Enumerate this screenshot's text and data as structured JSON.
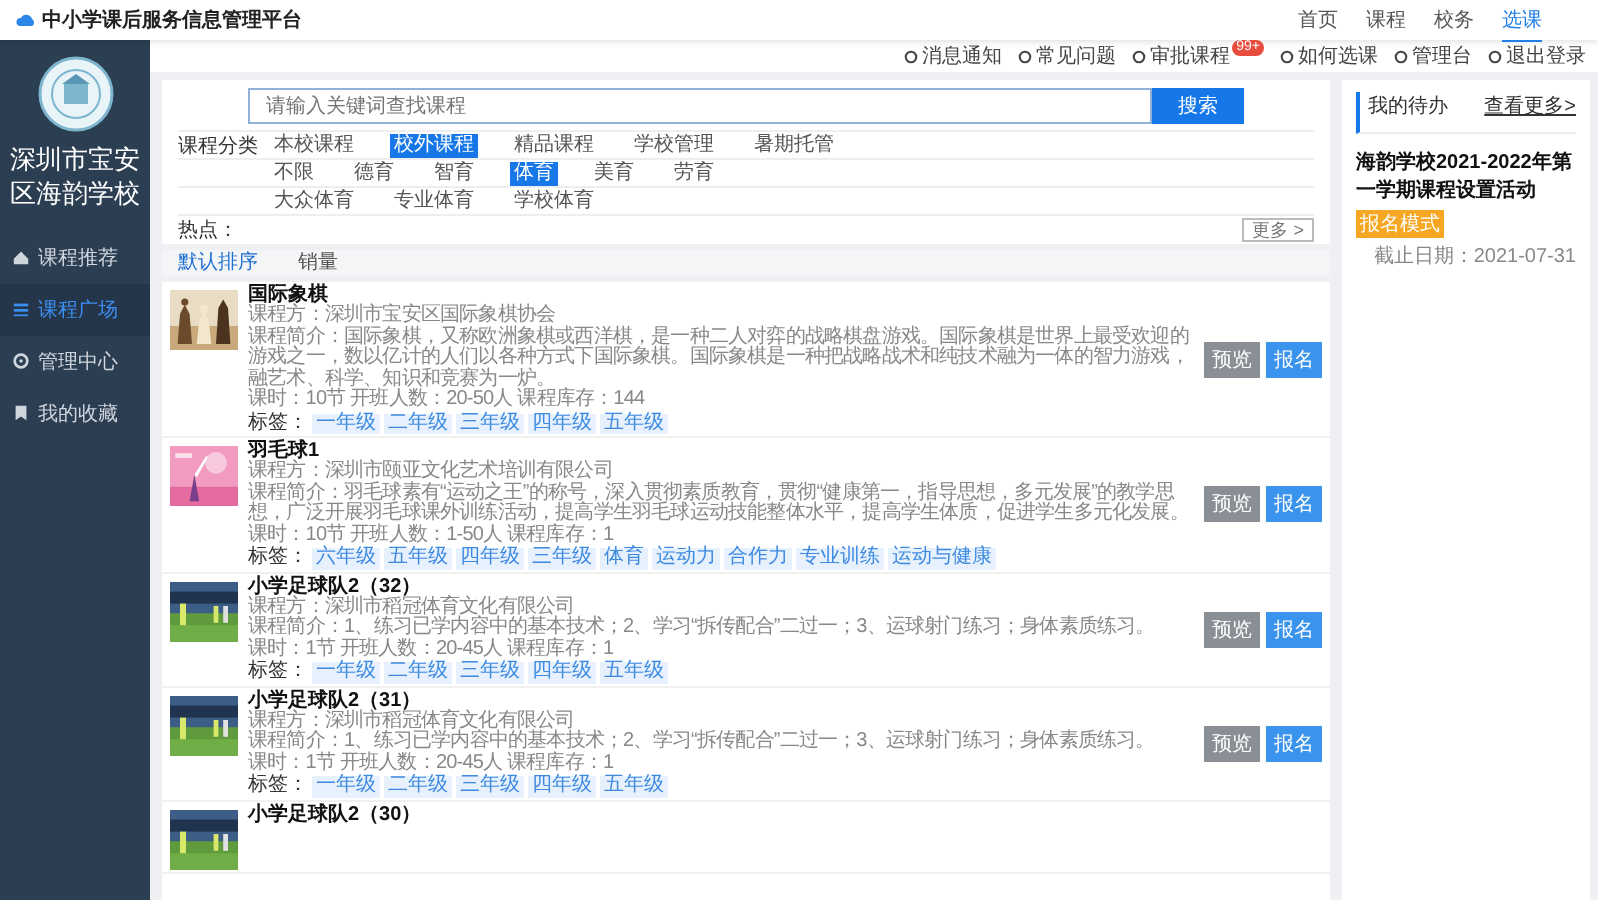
{
  "header": {
    "title": "中小学课后服务信息管理平台",
    "nav": [
      {
        "label": "首页",
        "selected": false
      },
      {
        "label": "课程",
        "selected": false
      },
      {
        "label": "校务",
        "selected": false
      },
      {
        "label": "选课",
        "selected": true
      }
    ]
  },
  "toolbar": [
    {
      "label": "消息通知"
    },
    {
      "label": "常见问题"
    },
    {
      "label": "审批课程",
      "badge": "99+"
    },
    {
      "label": "如何选课"
    },
    {
      "label": "管理台"
    },
    {
      "label": "退出登录"
    }
  ],
  "sidebar": {
    "school": "深圳市宝安区海韵学校",
    "items": [
      {
        "label": "课程推荐",
        "selected": false
      },
      {
        "label": "课程广场",
        "selected": true
      },
      {
        "label": "管理中心",
        "selected": false
      },
      {
        "label": "我的收藏",
        "selected": false
      }
    ]
  },
  "search": {
    "placeholder": "请输入关键词查找课程",
    "button": "搜索"
  },
  "filters": [
    {
      "label": "课程分类",
      "options": [
        {
          "label": "本校课程",
          "selected": false
        },
        {
          "label": "校外课程",
          "selected": true
        },
        {
          "label": "精品课程",
          "selected": false
        },
        {
          "label": "学校管理",
          "selected": false
        },
        {
          "label": "暑期托管",
          "selected": false
        }
      ]
    },
    {
      "options": [
        {
          "label": "不限",
          "selected": false
        },
        {
          "label": "德育",
          "selected": false
        },
        {
          "label": "智育",
          "selected": false
        },
        {
          "label": "体育",
          "selected": true
        },
        {
          "label": "美育",
          "selected": false
        },
        {
          "label": "劳育",
          "selected": false
        }
      ]
    },
    {
      "options": [
        {
          "label": "大众体育",
          "selected": false
        },
        {
          "label": "专业体育",
          "selected": false
        },
        {
          "label": "学校体育",
          "selected": false
        }
      ]
    }
  ],
  "hot": {
    "label": "热点：",
    "more": "更多 >"
  },
  "sort": [
    {
      "label": "默认排序",
      "selected": true
    },
    {
      "label": "销量",
      "selected": false
    }
  ],
  "courses": [
    {
      "title": "国际象棋",
      "provider": "课程方：深圳市宝安区国际象棋协会",
      "intro": "课程简介：国际象棋，又称欧洲象棋或西洋棋，是一种二人对弈的战略棋盘游戏。国际象棋是世界上最受欢迎的游戏之一，数以亿计的人们以各种方式下国际象棋。国际象棋是一种把战略战术和纯技术融为一体的智力游戏，融艺术、科学、知识和竞赛为一炉。",
      "info": "课时：10节  开班人数：20-50人  课程库存：144",
      "tag_label": "标签：",
      "tags": [
        "一年级",
        "二年级",
        "三年级",
        "四年级",
        "五年级"
      ],
      "preview": "预览",
      "enroll": "报名"
    },
    {
      "title": "羽毛球1",
      "provider": "课程方：深圳市颐亚文化艺术培训有限公司",
      "intro": "课程简介：羽毛球素有“运动之王”的称号，深入贯彻素质教育，贯彻“健康第一，指导思想，多元发展”的教学思想，广泛开展羽毛球课外训练活动，提高学生羽毛球运动技能整体水平，提高学生体质，促进学生多元化发展。",
      "info": "课时：10节  开班人数：1-50人  课程库存：1",
      "tag_label": "标签：",
      "tags": [
        "六年级",
        "五年级",
        "四年级",
        "三年级",
        "体育",
        "运动力",
        "合作力",
        "专业训练",
        "运动与健康"
      ],
      "preview": "预览",
      "enroll": "报名"
    },
    {
      "title": "小学足球队2（32）",
      "provider": "课程方：深圳市稻冠体育文化有限公司",
      "intro": "课程简介：1、练习已学内容中的基本技术；2、学习“拆传配合”二过一；3、运球射门练习；身体素质练习。",
      "info": "课时：1节  开班人数：20-45人  课程库存：1",
      "tag_label": "标签：",
      "tags": [
        "一年级",
        "二年级",
        "三年级",
        "四年级",
        "五年级"
      ],
      "preview": "预览",
      "enroll": "报名"
    },
    {
      "title": "小学足球队2（31）",
      "provider": "课程方：深圳市稻冠体育文化有限公司",
      "intro": "课程简介：1、练习已学内容中的基本技术；2、学习“拆传配合”二过一；3、运球射门练习；身体素质练习。",
      "info": "课时：1节  开班人数：20-45人  课程库存：1",
      "tag_label": "标签：",
      "tags": [
        "一年级",
        "二年级",
        "三年级",
        "四年级",
        "五年级"
      ],
      "preview": "预览",
      "enroll": "报名"
    },
    {
      "title": "小学足球队2（30）"
    }
  ],
  "todo": {
    "title": "我的待办",
    "more": "查看更多>",
    "item": {
      "title": "海韵学校2021-2022年第一学期课程设置活动",
      "badge": "报名模式",
      "deadline": "截止日期：2021-07-31"
    }
  }
}
